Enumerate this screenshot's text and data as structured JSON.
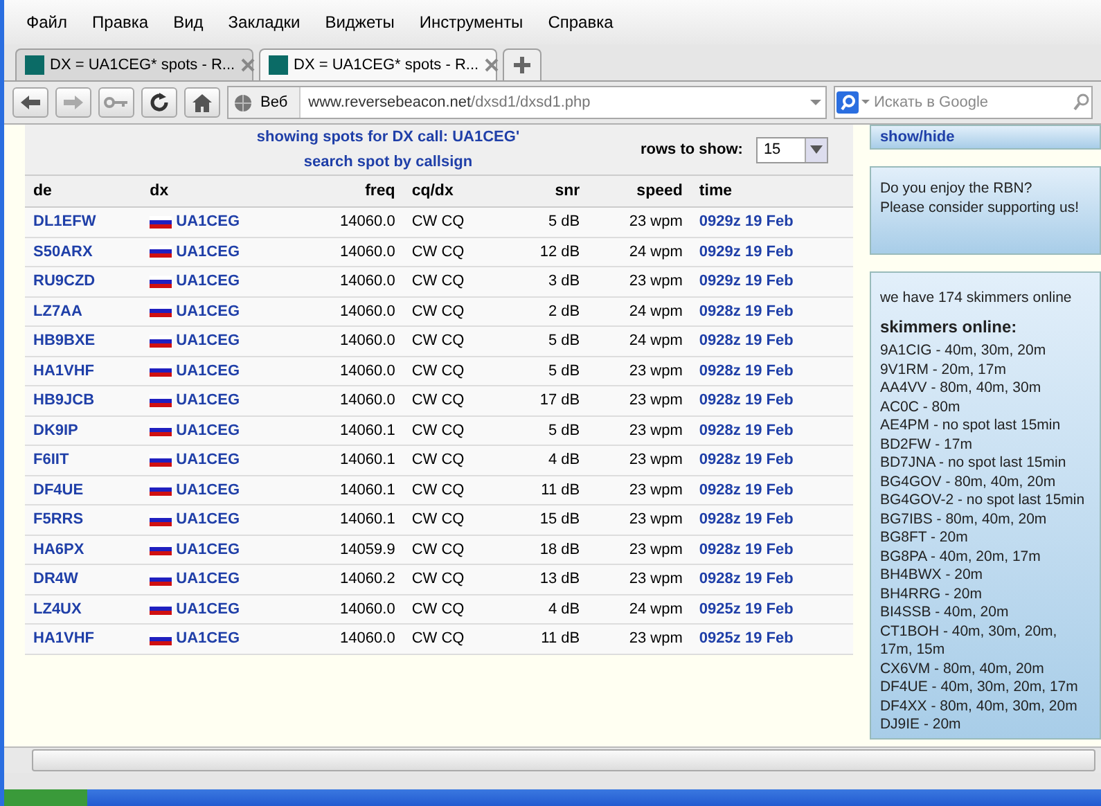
{
  "menu": [
    "Файл",
    "Правка",
    "Вид",
    "Закладки",
    "Виджеты",
    "Инструменты",
    "Справка"
  ],
  "tabs": [
    {
      "label": "DX = UA1CEG* spots - R...",
      "selected": false
    },
    {
      "label": "DX = UA1CEG* spots - R...",
      "selected": true
    }
  ],
  "address": {
    "prefix": "Веб",
    "host": "www.reversebeacon.net",
    "path": "/dxsd1/dxsd1.php"
  },
  "search": {
    "placeholder": "Искать в Google"
  },
  "spots": {
    "heading": "showing spots for DX call: UA1CEG'",
    "search_link": "search spot by callsign",
    "rows_label": "rows to show:",
    "rows_value": "15",
    "columns": [
      "de",
      "dx",
      "freq",
      "cq/dx",
      "snr",
      "speed",
      "time"
    ],
    "rows": [
      [
        "DL1EFW",
        "UA1CEG",
        "14060.0",
        "CW CQ",
        "5 dB",
        "23 wpm",
        "0929z 19 Feb"
      ],
      [
        "S50ARX",
        "UA1CEG",
        "14060.0",
        "CW CQ",
        "12 dB",
        "24 wpm",
        "0929z 19 Feb"
      ],
      [
        "RU9CZD",
        "UA1CEG",
        "14060.0",
        "CW CQ",
        "3 dB",
        "23 wpm",
        "0929z 19 Feb"
      ],
      [
        "LZ7AA",
        "UA1CEG",
        "14060.0",
        "CW CQ",
        "2 dB",
        "24 wpm",
        "0928z 19 Feb"
      ],
      [
        "HB9BXE",
        "UA1CEG",
        "14060.0",
        "CW CQ",
        "5 dB",
        "24 wpm",
        "0928z 19 Feb"
      ],
      [
        "HA1VHF",
        "UA1CEG",
        "14060.0",
        "CW CQ",
        "5 dB",
        "23 wpm",
        "0928z 19 Feb"
      ],
      [
        "HB9JCB",
        "UA1CEG",
        "14060.0",
        "CW CQ",
        "17 dB",
        "23 wpm",
        "0928z 19 Feb"
      ],
      [
        "DK9IP",
        "UA1CEG",
        "14060.1",
        "CW CQ",
        "5 dB",
        "23 wpm",
        "0928z 19 Feb"
      ],
      [
        "F6IIT",
        "UA1CEG",
        "14060.1",
        "CW CQ",
        "4 dB",
        "23 wpm",
        "0928z 19 Feb"
      ],
      [
        "DF4UE",
        "UA1CEG",
        "14060.1",
        "CW CQ",
        "11 dB",
        "23 wpm",
        "0928z 19 Feb"
      ],
      [
        "F5RRS",
        "UA1CEG",
        "14060.1",
        "CW CQ",
        "15 dB",
        "23 wpm",
        "0928z 19 Feb"
      ],
      [
        "HA6PX",
        "UA1CEG",
        "14059.9",
        "CW CQ",
        "18 dB",
        "23 wpm",
        "0928z 19 Feb"
      ],
      [
        "DR4W",
        "UA1CEG",
        "14060.2",
        "CW CQ",
        "13 dB",
        "23 wpm",
        "0928z 19 Feb"
      ],
      [
        "LZ4UX",
        "UA1CEG",
        "14060.0",
        "CW CQ",
        "4 dB",
        "24 wpm",
        "0925z 19 Feb"
      ],
      [
        "HA1VHF",
        "UA1CEG",
        "14060.0",
        "CW CQ",
        "11 dB",
        "23 wpm",
        "0925z 19 Feb"
      ]
    ]
  },
  "sidebar": {
    "toggle": "show/hide",
    "support": [
      "Do you enjoy the RBN?",
      "Please consider supporting us!"
    ],
    "count": "we have 174 skimmers online",
    "title": "skimmers online:",
    "skimmers": [
      "9A1CIG - 40m, 30m, 20m",
      "9V1RM - 20m, 17m",
      "AA4VV - 80m, 40m, 30m",
      "AC0C - 80m",
      "AE4PM - no spot last 15min",
      "BD2FW - 17m",
      "BD7JNA - no spot last 15min",
      "BG4GOV - 80m, 40m, 20m",
      "BG4GOV-2 - no spot last 15min",
      "BG7IBS - 80m, 40m, 20m",
      "BG8FT - 20m",
      "BG8PA - 40m, 20m, 17m",
      "BH4BWX - 20m",
      "BH4RRG - 20m",
      "BI4SSB - 40m, 20m",
      "CT1BOH - 40m, 30m, 20m, 17m, 15m",
      "CX6VM - 80m, 40m, 20m",
      "DF4UE - 40m, 30m, 20m, 17m",
      "DF4XX - 80m, 40m, 30m, 20m",
      "DJ9IE - 20m"
    ]
  }
}
